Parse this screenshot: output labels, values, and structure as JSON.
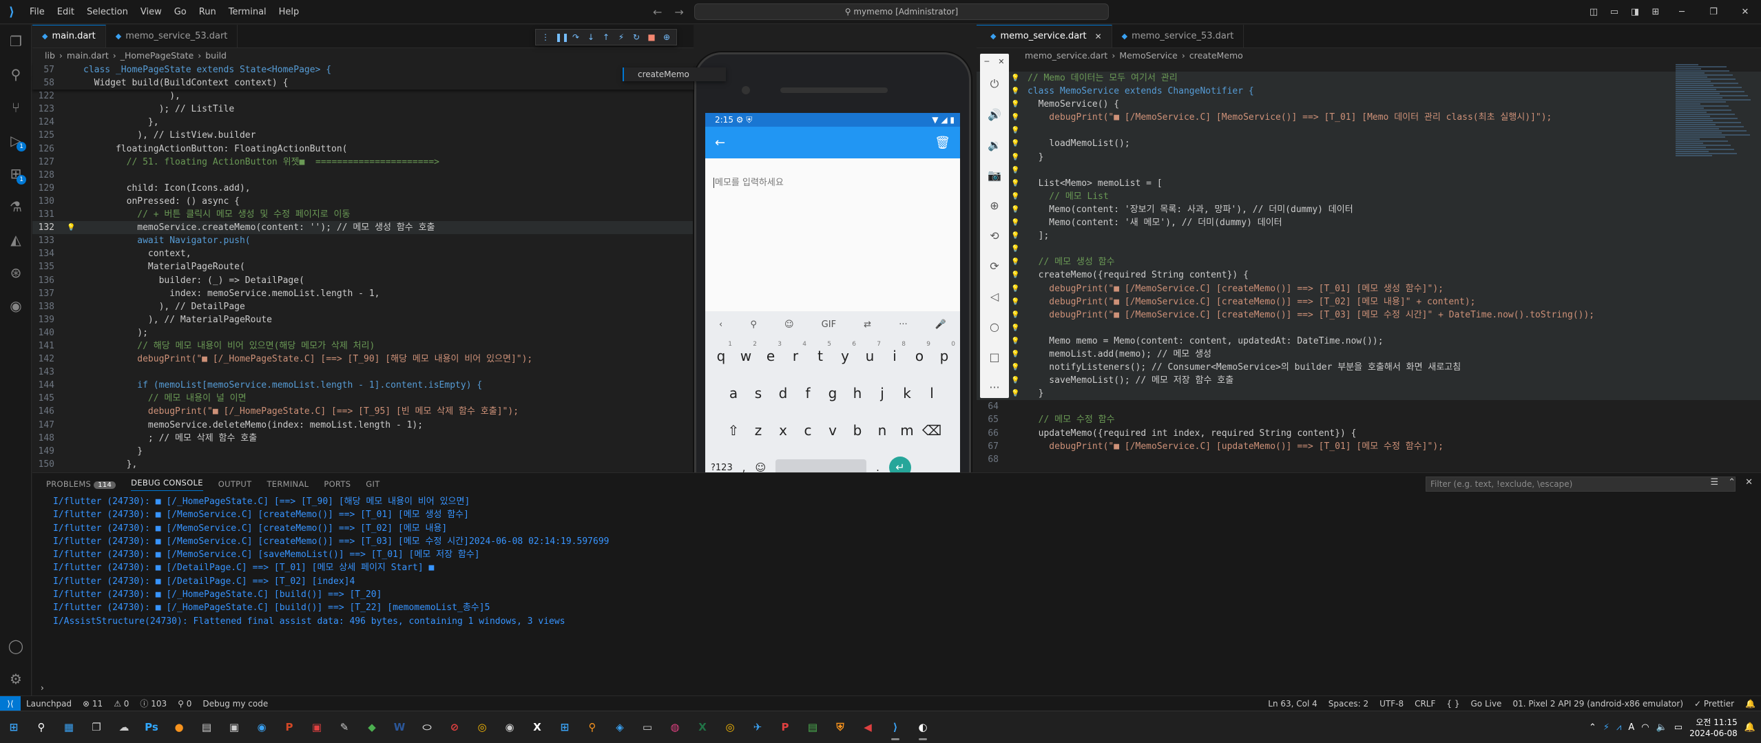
{
  "titlebar": {
    "menu": [
      "File",
      "Edit",
      "Selection",
      "View",
      "Go",
      "Run",
      "Terminal",
      "Help"
    ],
    "search": "mymemo [Administrator]"
  },
  "left_editor": {
    "tabs": [
      {
        "label": "main.dart",
        "active": true
      },
      {
        "label": "memo_service_53.dart",
        "active": false
      }
    ],
    "breadcrumb": [
      "lib",
      "main.dart",
      "_HomePageState",
      "build"
    ],
    "find_text": "createMemo",
    "sticky": [
      {
        "ln": "57",
        "text": "class _HomePageState extends State<HomePage> {"
      },
      {
        "ln": "58",
        "text": "  Widget build(BuildContext context) {"
      }
    ],
    "lines": [
      {
        "ln": "122",
        "text": "                ),"
      },
      {
        "ln": "123",
        "text": "              ); // ListTile"
      },
      {
        "ln": "124",
        "text": "            },"
      },
      {
        "ln": "125",
        "text": "          ), // ListView.builder"
      },
      {
        "ln": "126",
        "text": "      floatingActionButton: FloatingActionButton("
      },
      {
        "ln": "127",
        "text": "        // 51. floating ActionButton 위젯■  ======================>"
      },
      {
        "ln": "128",
        "text": ""
      },
      {
        "ln": "129",
        "text": "        child: Icon(Icons.add),"
      },
      {
        "ln": "130",
        "text": "        onPressed: () async {"
      },
      {
        "ln": "131",
        "text": "          // + 버튼 클릭시 메모 생성 및 수정 페이지로 이동"
      },
      {
        "ln": "132",
        "text": "          memoService.createMemo(content: ''); // 메모 생성 함수 호출"
      },
      {
        "ln": "133",
        "text": "          await Navigator.push("
      },
      {
        "ln": "134",
        "text": "            context,"
      },
      {
        "ln": "135",
        "text": "            MaterialPageRoute("
      },
      {
        "ln": "136",
        "text": "              builder: (_) => DetailPage("
      },
      {
        "ln": "137",
        "text": "                index: memoService.memoList.length - 1,"
      },
      {
        "ln": "138",
        "text": "              ), // DetailPage"
      },
      {
        "ln": "139",
        "text": "            ), // MaterialPageRoute"
      },
      {
        "ln": "140",
        "text": "          );"
      },
      {
        "ln": "141",
        "text": "          // 해당 메모 내용이 비어 있으면(해당 메모가 삭제 처리)"
      },
      {
        "ln": "142",
        "text": "          debugPrint(\"■ [/_HomePageState.C] [==> [T_90] [해당 메모 내용이 비어 있으면]\");"
      },
      {
        "ln": "143",
        "text": ""
      },
      {
        "ln": "144",
        "text": "          if (memoList[memoService.memoList.length - 1].content.isEmpty) {"
      },
      {
        "ln": "145",
        "text": "            // 메모 내용이 널 이면"
      },
      {
        "ln": "146",
        "text": "            debugPrint(\"■ [/_HomePageState.C] [==> [T_95] [빈 메모 삭제 함수 호출]\");"
      },
      {
        "ln": "147",
        "text": "            memoService.deleteMemo(index: memoList.length - 1);"
      },
      {
        "ln": "148",
        "text": "            ; // 메모 삭제 함수 호출"
      },
      {
        "ln": "149",
        "text": "          }"
      },
      {
        "ln": "150",
        "text": "        },"
      }
    ]
  },
  "right_editor": {
    "tabs": [
      {
        "label": "memo_service.dart",
        "active": true
      },
      {
        "label": "memo_service_53.dart",
        "active": false
      }
    ],
    "breadcrumb": [
      "memo_service.dart",
      "MemoService",
      "createMemo"
    ],
    "lines": [
      {
        "ln": "",
        "text": "// Memo 데이터는 모두 여기서 관리"
      },
      {
        "ln": "",
        "text": "class MemoService extends ChangeNotifier {"
      },
      {
        "ln": "",
        "text": "  MemoService() {"
      },
      {
        "ln": "",
        "text": "    debugPrint(\"■ [/MemoService.C] [MemoService()] ==> [T_01] [Memo 데이터 관리 class(최초 실행시)]\");"
      },
      {
        "ln": "",
        "text": ""
      },
      {
        "ln": "",
        "text": "    loadMemoList();"
      },
      {
        "ln": "",
        "text": "  }"
      },
      {
        "ln": "",
        "text": ""
      },
      {
        "ln": "",
        "text": "  List<Memo> memoList = ["
      },
      {
        "ln": "",
        "text": "    // 메모 List"
      },
      {
        "ln": "",
        "text": "    Memo(content: '장보기 목록: 사과, 망파'), // 더미(dummy) 데이터"
      },
      {
        "ln": "",
        "text": "    Memo(content: '새 메모'), // 더미(dummy) 데이터"
      },
      {
        "ln": "",
        "text": "  ];"
      },
      {
        "ln": "",
        "text": ""
      },
      {
        "ln": "",
        "text": "  // 메모 생성 함수"
      },
      {
        "ln": "",
        "text": "  createMemo({required String content}) {"
      },
      {
        "ln": "",
        "text": "    debugPrint(\"■ [/MemoService.C] [createMemo()] ==> [T_01] [메모 생성 함수]\");"
      },
      {
        "ln": "",
        "text": "    debugPrint(\"■ [/MemoService.C] [createMemo()] ==> [T_02] [메모 내용]\" + content);"
      },
      {
        "ln": "",
        "text": "    debugPrint(\"■ [/MemoService.C] [createMemo()] ==> [T_03] [메모 수정 시간]\" + DateTime.now().toString());"
      },
      {
        "ln": "",
        "text": ""
      },
      {
        "ln": "",
        "text": "    Memo memo = Memo(content: content, updatedAt: DateTime.now());"
      },
      {
        "ln": "",
        "text": "    memoList.add(memo); // 메모 생성"
      },
      {
        "ln": "",
        "text": "    notifyListeners(); // Consumer<MemoService>의 builder 부분을 호출해서 화면 새로고침"
      },
      {
        "ln": "",
        "text": "    saveMemoList(); // 메모 저장 함수 호출"
      },
      {
        "ln": "",
        "text": "  }"
      },
      {
        "ln": "64",
        "text": ""
      },
      {
        "ln": "65",
        "text": "  // 메모 수정 함수"
      },
      {
        "ln": "66",
        "text": "  updateMemo({required int index, required String content}) {"
      },
      {
        "ln": "67",
        "text": "    debugPrint(\"■ [/MemoService.C] [updateMemo()] ==> [T_01] [메모 수정 함수]\");"
      },
      {
        "ln": "68",
        "text": ""
      }
    ]
  },
  "panel": {
    "tabs": [
      "PROBLEMS",
      "DEBUG CONSOLE",
      "OUTPUT",
      "TERMINAL",
      "PORTS",
      "GIT"
    ],
    "problems_count": "114",
    "filter_placeholder": "Filter (e.g. text, !exclude, \\escape)",
    "console": [
      "I/flutter (24730): ■ [/_HomePageState.C] [==> [T_90] [해당 메모 내용이 비어 있으면]",
      "I/flutter (24730): ■ [/MemoService.C] [createMemo()] ==> [T_01] [메모 생성 함수]",
      "I/flutter (24730): ■ [/MemoService.C] [createMemo()] ==> [T_02] [메모 내용]",
      "I/flutter (24730): ■ [/MemoService.C] [createMemo()] ==> [T_03] [메모 수정 시간]2024-06-08 02:14:19.597699",
      "I/flutter (24730): ■ [/MemoService.C] [saveMemoList()] ==> [T_01] [메모 저장 함수]",
      "I/flutter (24730): ■ [/DetailPage.C] ==> [T_01] [메모 상세 페이지 Start] ■",
      "I/flutter (24730): ■ [/DetailPage.C] ==> [T_02] [index]4",
      "I/flutter (24730): ■ [/_HomePageState.C] [build()] ==> [T_20]",
      "I/flutter (24730): ■ [/_HomePageState.C] [build()] ==> [T_22] [memomemoList_총수]5",
      "I/AssistStructure(24730): Flattened final assist data: 496 bytes, containing 1 windows, 3 views"
    ]
  },
  "phone": {
    "time": "2:15",
    "placeholder": "메모를 입력하세요",
    "kb_row1": [
      "q",
      "w",
      "e",
      "r",
      "t",
      "y",
      "u",
      "i",
      "o",
      "p"
    ],
    "kb_row1_nums": [
      "1",
      "2",
      "3",
      "4",
      "5",
      "6",
      "7",
      "8",
      "9",
      "0"
    ],
    "kb_row2": [
      "a",
      "s",
      "d",
      "f",
      "g",
      "h",
      "j",
      "k",
      "l"
    ],
    "kb_row3": [
      "z",
      "x",
      "c",
      "v",
      "b",
      "n",
      "m"
    ],
    "kb_symbols": "?123",
    "kb_comma": ",",
    "kb_period": ".",
    "gif": "GIF"
  },
  "statusbar": {
    "launchpad": "Launchpad",
    "errors": "⊗ 11",
    "warnings": "⚠ 0",
    "info": "ⓘ 103",
    "ports": "⚲ 0",
    "debug": "Debug my code",
    "position": "Ln 63, Col 4",
    "spaces": "Spaces: 2",
    "encoding": "UTF-8",
    "eol": "CRLF",
    "braces": "{ }",
    "golive": "Go Live",
    "device": "01. Pixel 2 API 29 (android-x86 emulator)",
    "prettier": "✓ Prettier"
  },
  "taskbar": {
    "time": "오전 11:15",
    "date": "2024-06-08",
    "lang": "A"
  },
  "colors": {
    "accent": "#0078d4",
    "app_bar": "#2196f3",
    "status_bar": "#1976d2",
    "console_text": "#3794ff"
  }
}
